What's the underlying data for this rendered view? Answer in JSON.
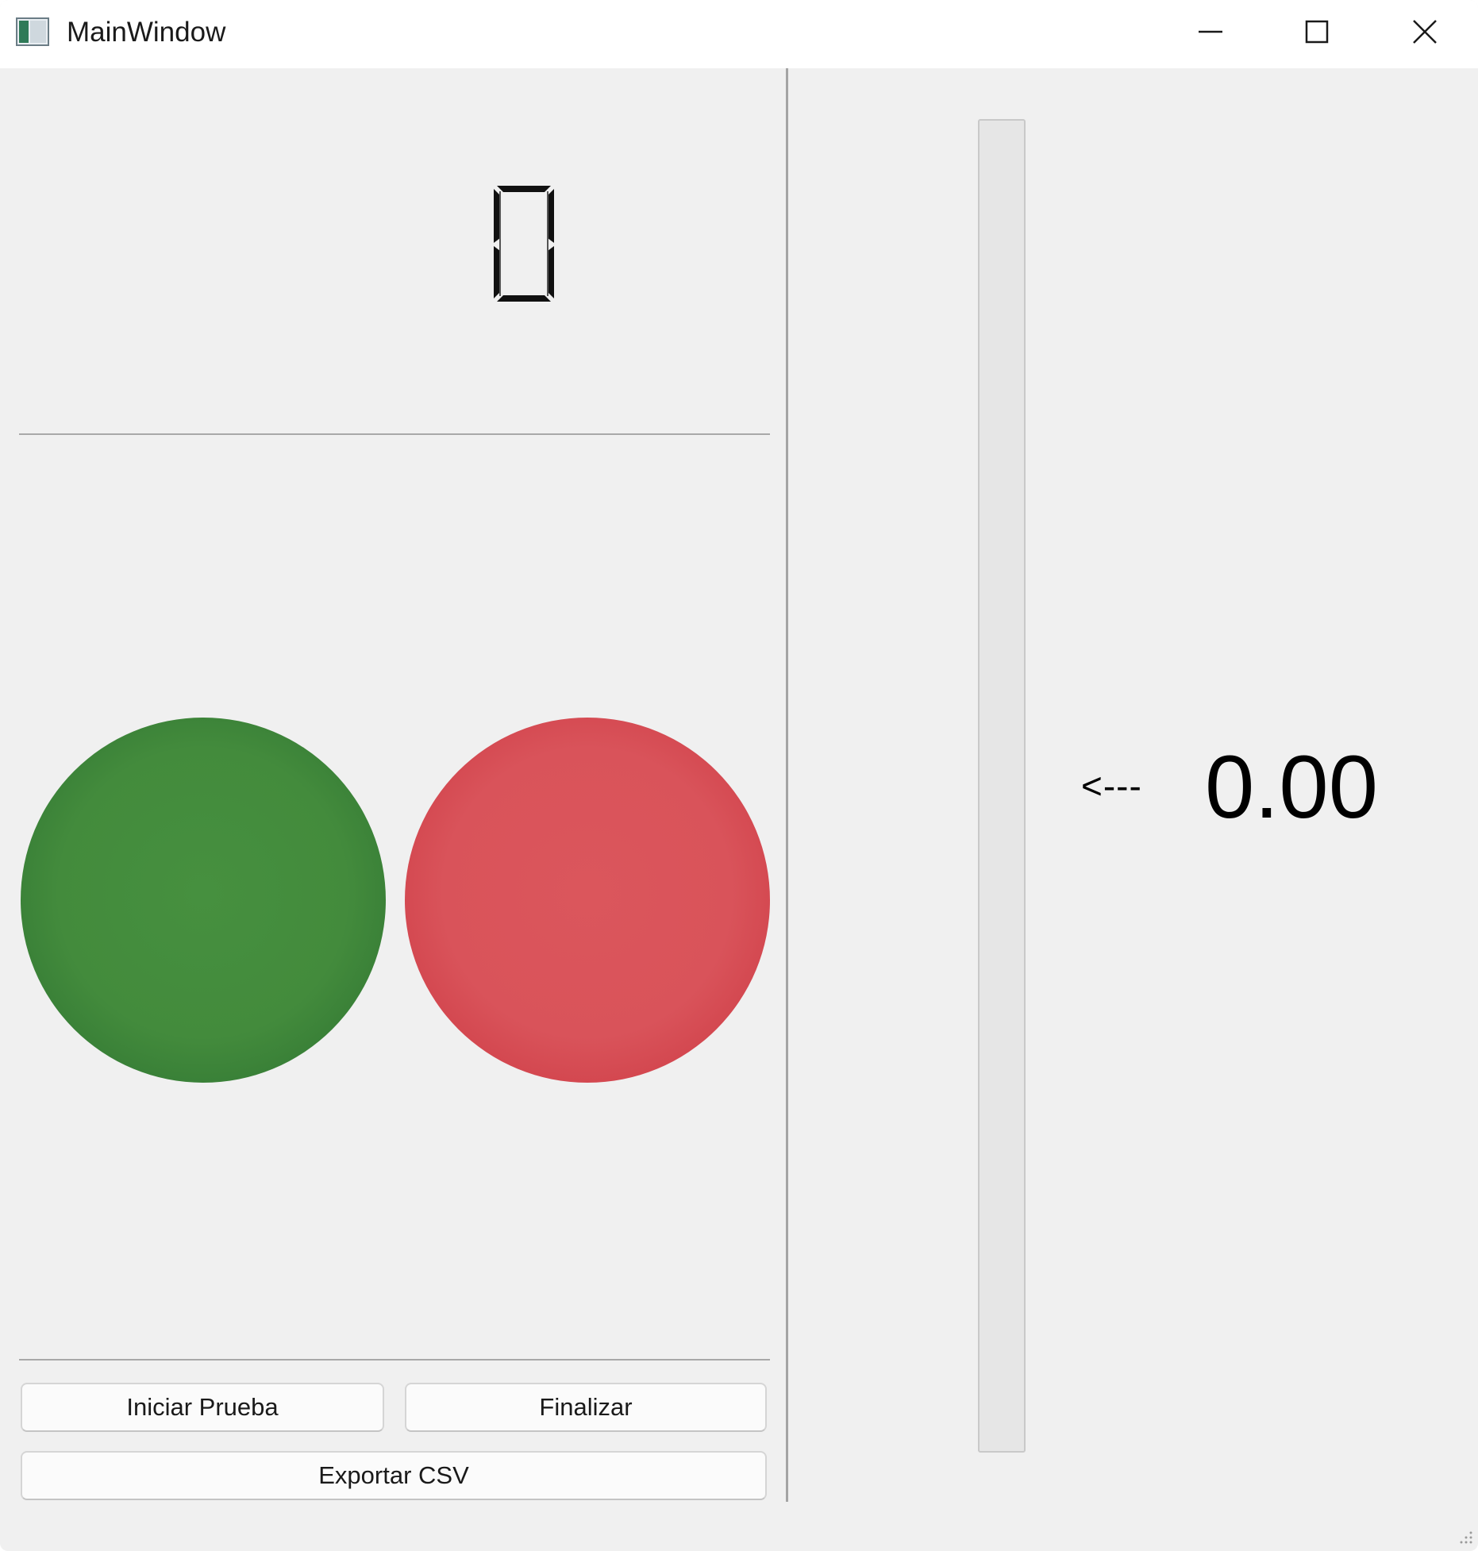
{
  "window": {
    "title": "MainWindow",
    "app_icon": "app-window-icon",
    "controls": [
      "minimize-icon",
      "maximize-icon",
      "close-icon"
    ]
  },
  "display": {
    "lcd_value": "0"
  },
  "indicators": {
    "green_led": {
      "icon": "green-led-icon",
      "color": "#438b3c",
      "state": "on"
    },
    "red_led": {
      "icon": "red-led-icon",
      "color": "#d9535a",
      "state": "on"
    }
  },
  "buttons": {
    "start_label": "Iniciar Prueba",
    "finish_label": "Finalizar",
    "export_label": "Exportar CSV"
  },
  "gauge": {
    "progress_fraction": 0,
    "arrow_label": "<---",
    "value_label": "0.00"
  }
}
